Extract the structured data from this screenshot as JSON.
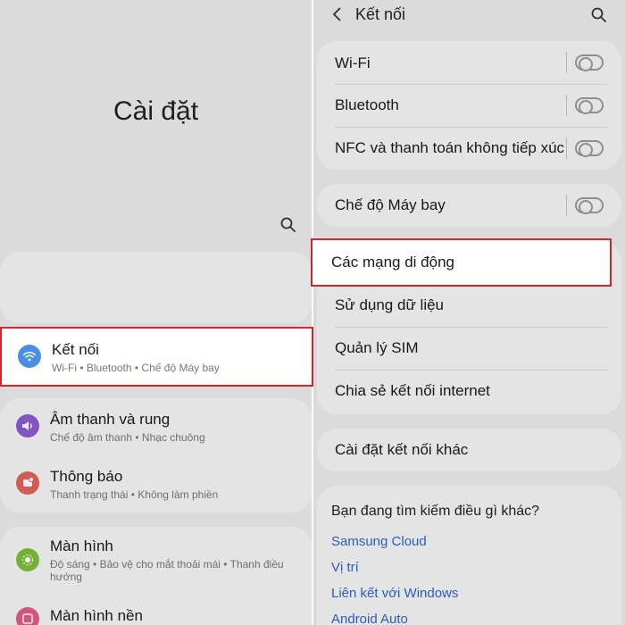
{
  "left": {
    "title": "Cài đặt",
    "items": [
      {
        "title": "Kết nối",
        "subtitle": "Wi-Fi • Bluetooth • Chế độ Máy bay",
        "icon": "wifi-icon",
        "color": "#4a90e2"
      },
      {
        "title": "Âm thanh và rung",
        "subtitle": "Chế độ âm thanh • Nhạc chuông",
        "icon": "speaker-icon",
        "color": "#8a5cd1"
      },
      {
        "title": "Thông báo",
        "subtitle": "Thanh trạng thái • Không làm phiền",
        "icon": "notification-icon",
        "color": "#e2625a"
      },
      {
        "title": "Màn hình",
        "subtitle": "Độ sáng • Bảo vệ cho mắt thoải mái • Thanh điều hướng",
        "icon": "brightness-icon",
        "color": "#7dbd3b"
      },
      {
        "title": "Màn hình nền",
        "subtitle": "",
        "icon": "wallpaper-icon",
        "color": "#e05d8a"
      }
    ]
  },
  "right": {
    "title": "Kết nối",
    "toggles": [
      {
        "label": "Wi-Fi"
      },
      {
        "label": "Bluetooth"
      },
      {
        "label": "NFC và thanh toán không tiếp xúc"
      }
    ],
    "airplane": {
      "label": "Chế độ Máy bay"
    },
    "group": [
      {
        "label": "Các mạng di động"
      },
      {
        "label": "Sử dụng dữ liệu"
      },
      {
        "label": "Quản lý SIM"
      },
      {
        "label": "Chia sẻ kết nối internet"
      }
    ],
    "more": {
      "label": "Cài đặt kết nối khác"
    },
    "suggest": {
      "heading": "Bạn đang tìm kiếm điều gì khác?",
      "links": [
        "Samsung Cloud",
        "Vị trí",
        "Liên kết với Windows",
        "Android Auto"
      ]
    }
  },
  "colors": {
    "highlight": "#d3262b",
    "link": "#2f66c9"
  }
}
